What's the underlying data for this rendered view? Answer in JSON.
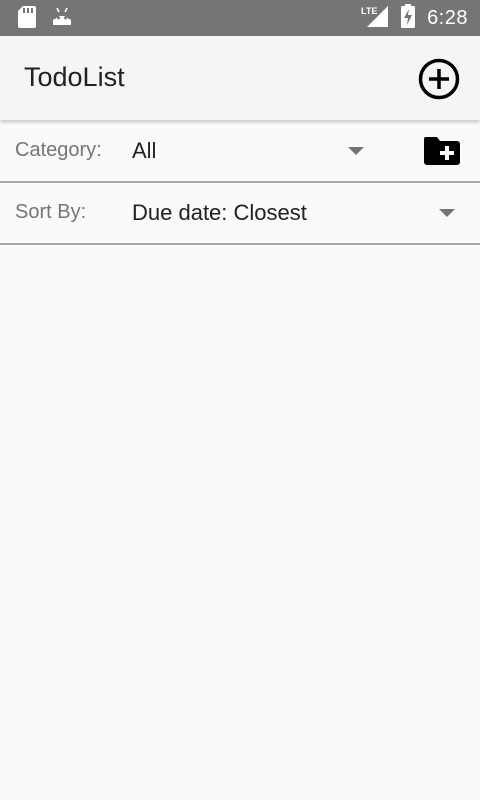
{
  "status_bar": {
    "time": "6:28",
    "network_label": "LTE",
    "icons": [
      "sd-card-icon",
      "android-icon",
      "lte-signal-icon",
      "battery-charging-icon"
    ]
  },
  "app_bar": {
    "title": "TodoList",
    "add_icon": "add-circle-icon"
  },
  "filters": {
    "category": {
      "label": "Category:",
      "selected": "All",
      "add_icon": "add-folder-icon"
    },
    "sort": {
      "label": "Sort By:",
      "selected": "Due date: Closest"
    }
  },
  "colors": {
    "status_bar": "#757575",
    "app_bar": "#f5f5f5",
    "background": "#fafafa",
    "divider": "#a8a8a8",
    "label_text": "#757575",
    "value_text": "#212121"
  }
}
